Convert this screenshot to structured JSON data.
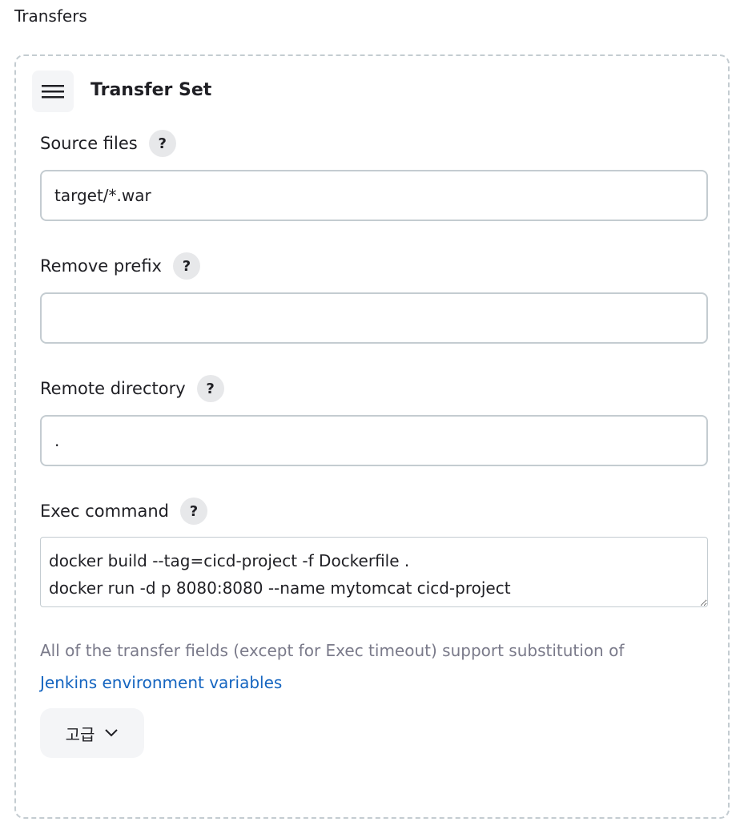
{
  "section_title": "Transfers",
  "transfer_set": {
    "title": "Transfer Set",
    "drag_icon": "hamburger-icon",
    "help_glyph": "?",
    "fields": [
      {
        "label": "Source files",
        "value": "target/*.war"
      },
      {
        "label": "Remove prefix",
        "value": ""
      },
      {
        "label": "Remote directory",
        "value": "."
      }
    ],
    "exec_command": {
      "label": "Exec command",
      "value": "docker build --tag=cicd-project -f Dockerfile .\ndocker run -d p 8080:8080 --name mytomcat cicd-project"
    },
    "hint_text": "All of the transfer fields (except for Exec timeout) support substitution of",
    "hint_link": "Jenkins environment variables",
    "advanced_label": "고급",
    "advanced_icon": "chevron-down-icon"
  },
  "colors": {
    "border": "#c4ccd1",
    "link": "#1565c0",
    "hint": "#7a7a8a"
  }
}
